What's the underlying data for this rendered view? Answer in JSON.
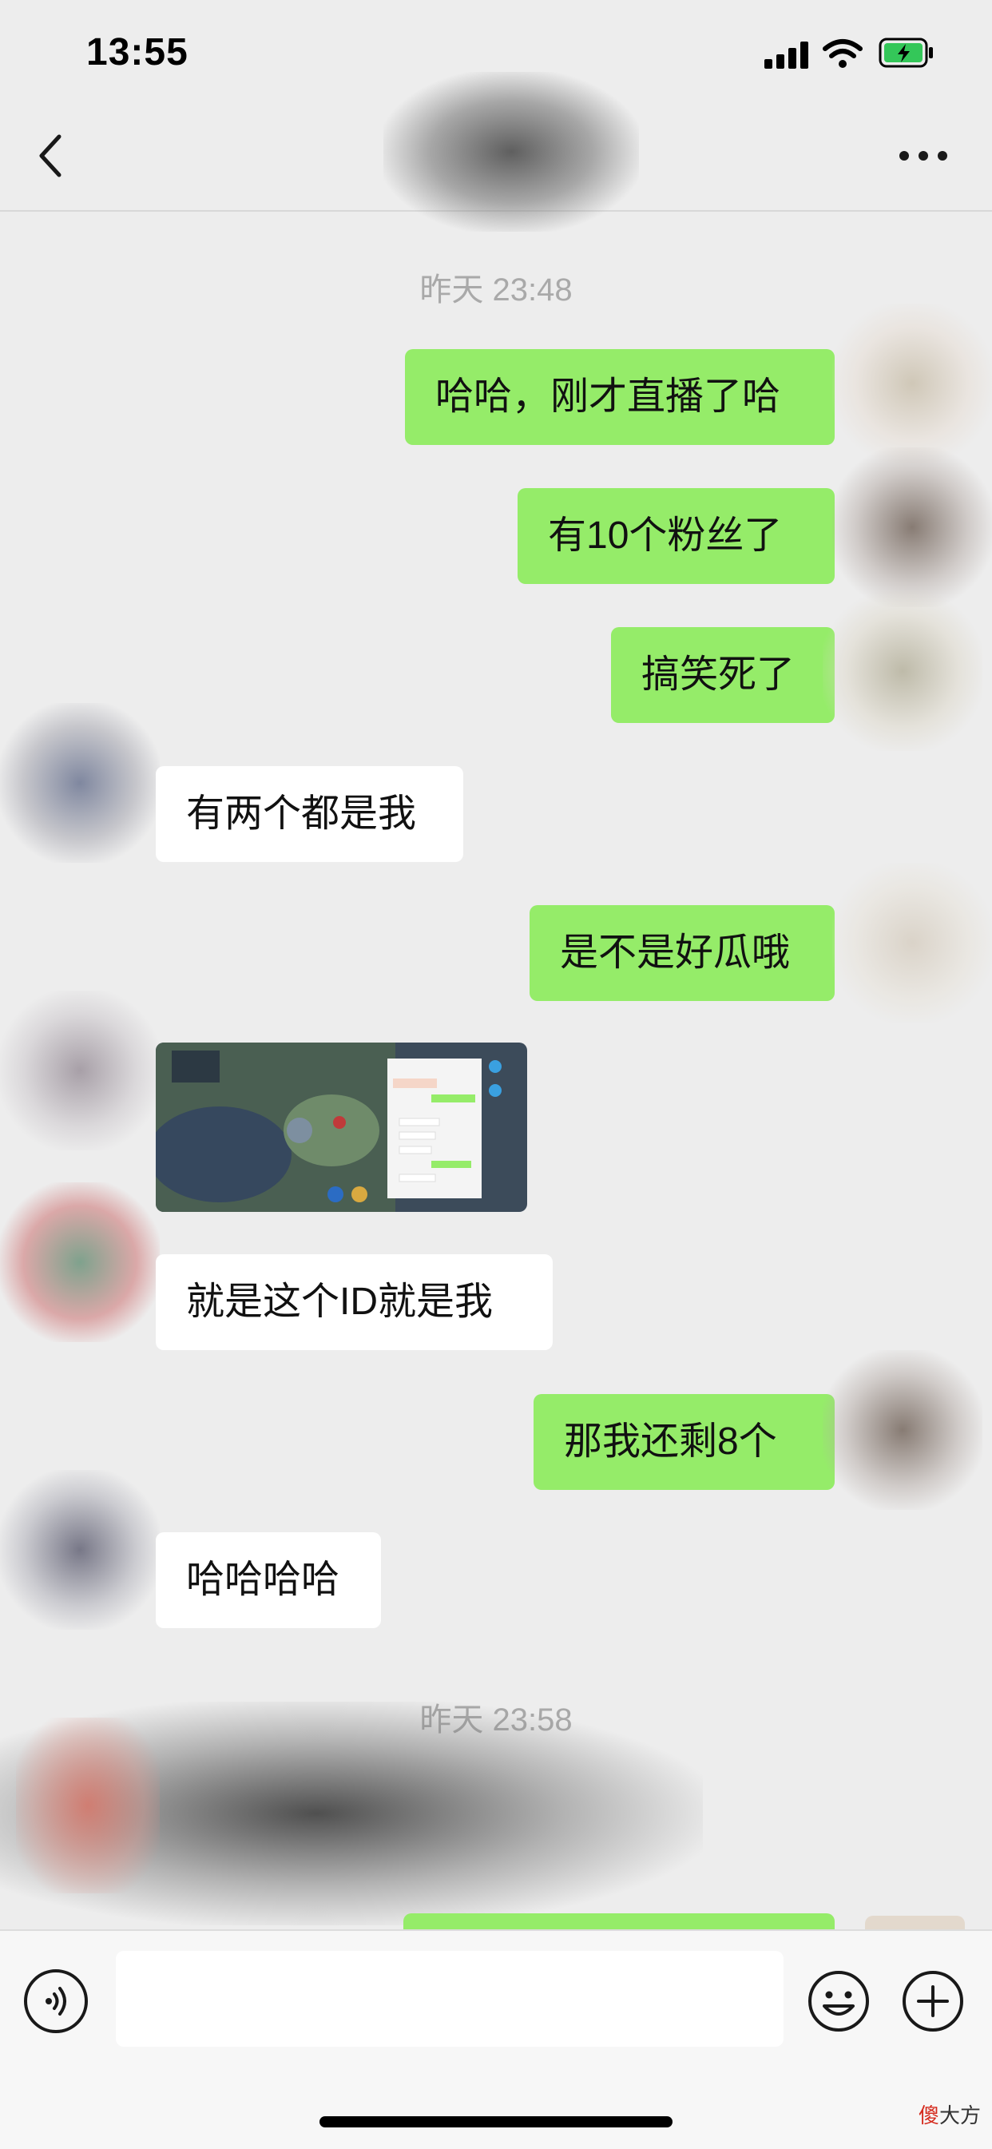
{
  "status_bar": {
    "time": "13:55"
  },
  "chat": {
    "timestamps": [
      "昨天 23:48",
      "昨天 23:58"
    ],
    "messages": [
      {
        "side": "me",
        "text": "哈哈，刚才直播了哈"
      },
      {
        "side": "me",
        "text": "有10个粉丝了"
      },
      {
        "side": "me",
        "text": "搞笑死了"
      },
      {
        "side": "them",
        "text": "有两个都是我"
      },
      {
        "side": "me",
        "text": "是不是好瓜哦"
      },
      {
        "side": "them",
        "type": "image"
      },
      {
        "side": "them",
        "text": "就是这个ID就是我"
      },
      {
        "side": "me",
        "text": "那我还剩8个"
      },
      {
        "side": "them",
        "text": "哈哈哈哈"
      }
    ]
  },
  "input": {
    "placeholder": ""
  },
  "watermark": {
    "accent": "傻",
    "text": "大方"
  },
  "colors": {
    "my_bubble": "#95ec69",
    "their_bubble": "#ffffff",
    "background": "#ededed"
  }
}
